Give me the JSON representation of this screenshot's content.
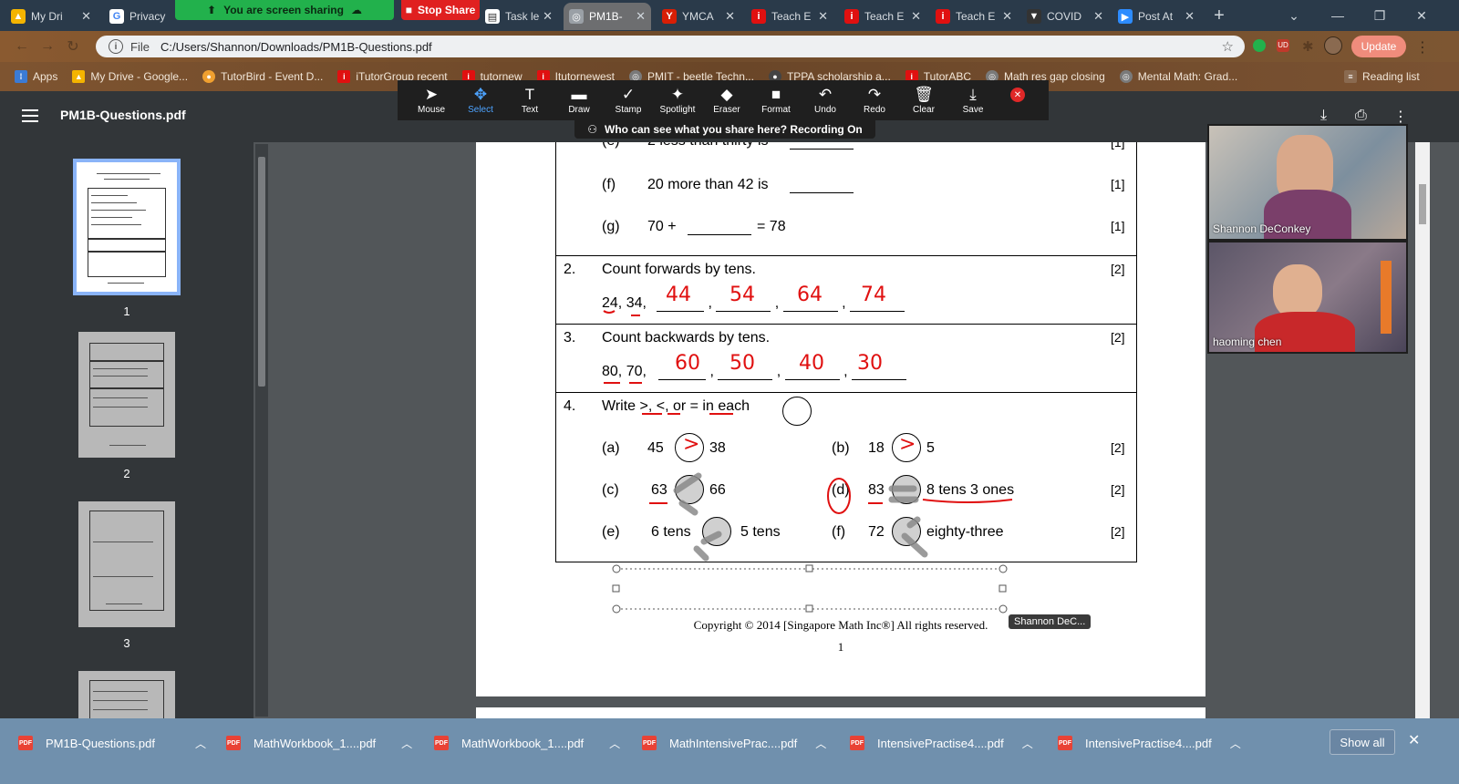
{
  "tabs": [
    {
      "label": "My Dri",
      "fav": "drive-icon",
      "color": "#f4b400"
    },
    {
      "label": "Privacy",
      "fav": "google-icon",
      "color": "#ffffff"
    },
    {
      "label": "Task le",
      "fav": "doc-icon",
      "color": "#ffffff"
    },
    {
      "label": "PM1B-",
      "fav": "globe-icon",
      "color": "#9aa0a6",
      "active": true
    },
    {
      "label": "YMCA",
      "fav": "ymca-icon",
      "color": "#d81e05"
    },
    {
      "label": "Teach E",
      "fav": "i-icon",
      "color": "#e01010"
    },
    {
      "label": "Teach E",
      "fav": "i-icon",
      "color": "#e01010"
    },
    {
      "label": "Teach E",
      "fav": "i-icon",
      "color": "#e01010"
    },
    {
      "label": "COVID",
      "fav": "shield-icon",
      "color": "#333333"
    },
    {
      "label": "Post At",
      "fav": "zoom-icon",
      "color": "#2d8cff"
    }
  ],
  "screen_share": {
    "sharing_label": "You are screen sharing",
    "stop_label": "Stop Share"
  },
  "browser": {
    "scheme": "File",
    "url": "C:/Users/Shannon/Downloads/PM1B-Questions.pdf",
    "update_label": "Update"
  },
  "bookmarks": [
    {
      "label": "Apps"
    },
    {
      "label": "My Drive - Google..."
    },
    {
      "label": "TutorBird - Event D..."
    },
    {
      "label": "iTutorGroup recent"
    },
    {
      "label": "tutornew"
    },
    {
      "label": "Itutornewest"
    },
    {
      "label": "PMIT - beetle Techn..."
    },
    {
      "label": "TPPA scholarship a..."
    },
    {
      "label": "TutorABC"
    },
    {
      "label": "Math res gap closing"
    },
    {
      "label": "Mental Math: Grad..."
    },
    {
      "label": "Reading list"
    }
  ],
  "annotation_tools": [
    {
      "label": "Mouse",
      "glyph": "➤"
    },
    {
      "label": "Select",
      "glyph": "✥",
      "selected": true
    },
    {
      "label": "Text",
      "glyph": "T"
    },
    {
      "label": "Draw",
      "glyph": "▬"
    },
    {
      "label": "Stamp",
      "glyph": "✓"
    },
    {
      "label": "Spotlight",
      "glyph": "✦"
    },
    {
      "label": "Eraser",
      "glyph": "◆"
    },
    {
      "label": "Format",
      "glyph": "■"
    },
    {
      "label": "Undo",
      "glyph": "↶"
    },
    {
      "label": "Redo",
      "glyph": "↷"
    },
    {
      "label": "Clear",
      "glyph": "🗑"
    },
    {
      "label": "Save",
      "glyph": "⤓"
    }
  ],
  "recording_notice": "Who can see what you share here? Recording On",
  "pdf": {
    "title": "PM1B-Questions.pdf",
    "page_numbers": [
      "1",
      "2",
      "3"
    ],
    "footer_page": "1",
    "copyright": "Copyright © 2014 [Singapore Math Inc®] All rights reserved."
  },
  "worksheet": {
    "q1e": {
      "label": "(e)",
      "text": "2 less than thirty is",
      "marks": "[1]"
    },
    "q1f": {
      "label": "(f)",
      "text": "20 more than 42 is",
      "marks": "[1]"
    },
    "q1g": {
      "label": "(g)",
      "pre": "70 +",
      "post": "= 78",
      "marks": "[1]"
    },
    "q2": {
      "num": "2.",
      "text": "Count forwards by tens.",
      "marks": "[2]",
      "given": "24, 34,",
      "answers": [
        "44",
        "54",
        "64",
        "74"
      ]
    },
    "q3": {
      "num": "3.",
      "text": "Count backwards by tens.",
      "marks": "[2]",
      "given": "80, 70,",
      "answers": [
        "60",
        "50",
        "40",
        "30"
      ]
    },
    "q4": {
      "num": "4.",
      "text": "Write >, <, or = in each",
      "items": [
        {
          "label": "(a)",
          "left": "45",
          "right": "38",
          "answer": ">"
        },
        {
          "label": "(b)",
          "left": "18",
          "right": "5",
          "answer": ">"
        },
        {
          "label": "(c)",
          "left": "63",
          "right": "66"
        },
        {
          "label": "(d)",
          "left": "83",
          "right": "8 tens 3 ones"
        },
        {
          "label": "(e)",
          "left": "6 tens",
          "right": "5 tens"
        },
        {
          "label": "(f)",
          "left": "72",
          "right": "eighty-three"
        }
      ],
      "marks": [
        "[2]",
        "[2]",
        "[2]"
      ]
    }
  },
  "participants": [
    {
      "name": "Shannon DeConkey"
    },
    {
      "name": "haoming   chen"
    }
  ],
  "tooltip": "Shannon DeC...",
  "downloads": [
    {
      "label": "PM1B-Questions.pdf"
    },
    {
      "label": "MathWorkbook_1....pdf"
    },
    {
      "label": "MathWorkbook_1....pdf"
    },
    {
      "label": "MathIntensivePrac....pdf"
    },
    {
      "label": "IntensivePractise4....pdf"
    },
    {
      "label": "IntensivePractise4....pdf"
    }
  ],
  "show_all_label": "Show all"
}
